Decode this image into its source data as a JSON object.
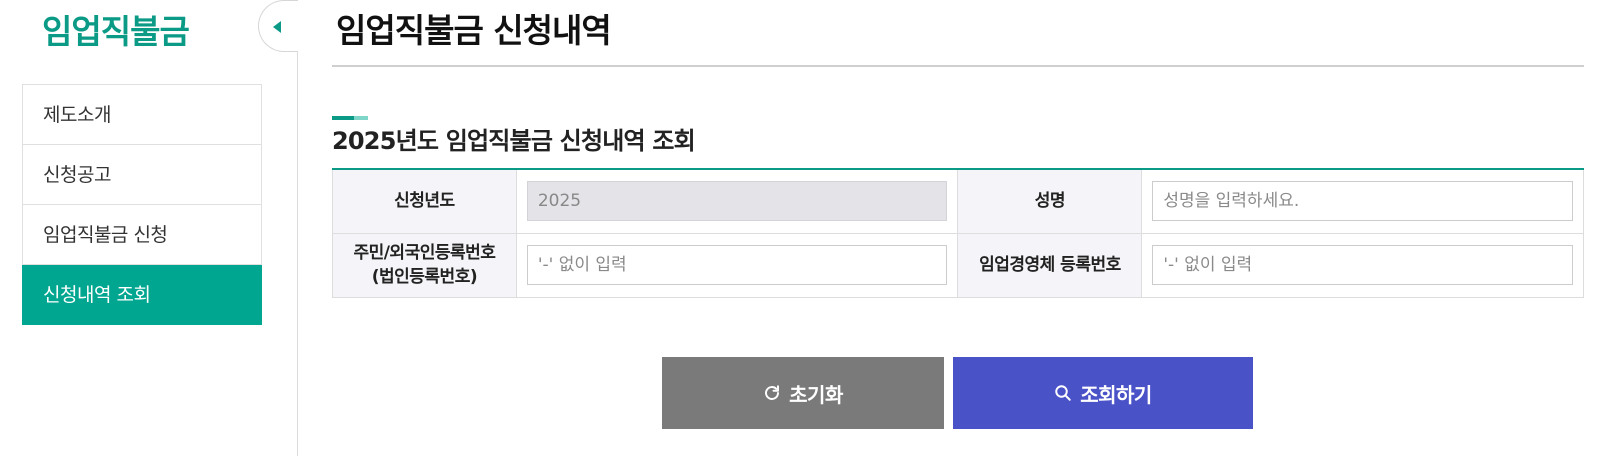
{
  "sidebar": {
    "title": "임업직불금",
    "items": [
      {
        "label": "제도소개"
      },
      {
        "label": "신청공고"
      },
      {
        "label": "임업직불금 신청"
      },
      {
        "label": "신청내역 조회",
        "active": true
      }
    ]
  },
  "main": {
    "page_title": "임업직불금 신청내역",
    "section_title": "2025년도 임업직불금 신청내역 조회",
    "form": {
      "year_label": "신청년도",
      "year_value": "2025",
      "name_label": "성명",
      "name_placeholder": "성명을 입력하세요.",
      "id_label_line1": "주민/외국인등록번호",
      "id_label_line2": "(법인등록번호)",
      "id_placeholder": "'-' 없이 입력",
      "biz_label": "임업경영체 등록번호",
      "biz_placeholder": "'-' 없이 입력"
    },
    "buttons": {
      "reset_label": "초기화",
      "search_label": "조회하기"
    }
  },
  "colors": {
    "accent": "#0a9a86",
    "active_menu": "#00a690",
    "search_button": "#4a52c8",
    "reset_button": "#7a7a7a"
  },
  "icons": {
    "toggle": "caret-left-icon",
    "reset": "refresh-icon",
    "search": "search-icon"
  }
}
